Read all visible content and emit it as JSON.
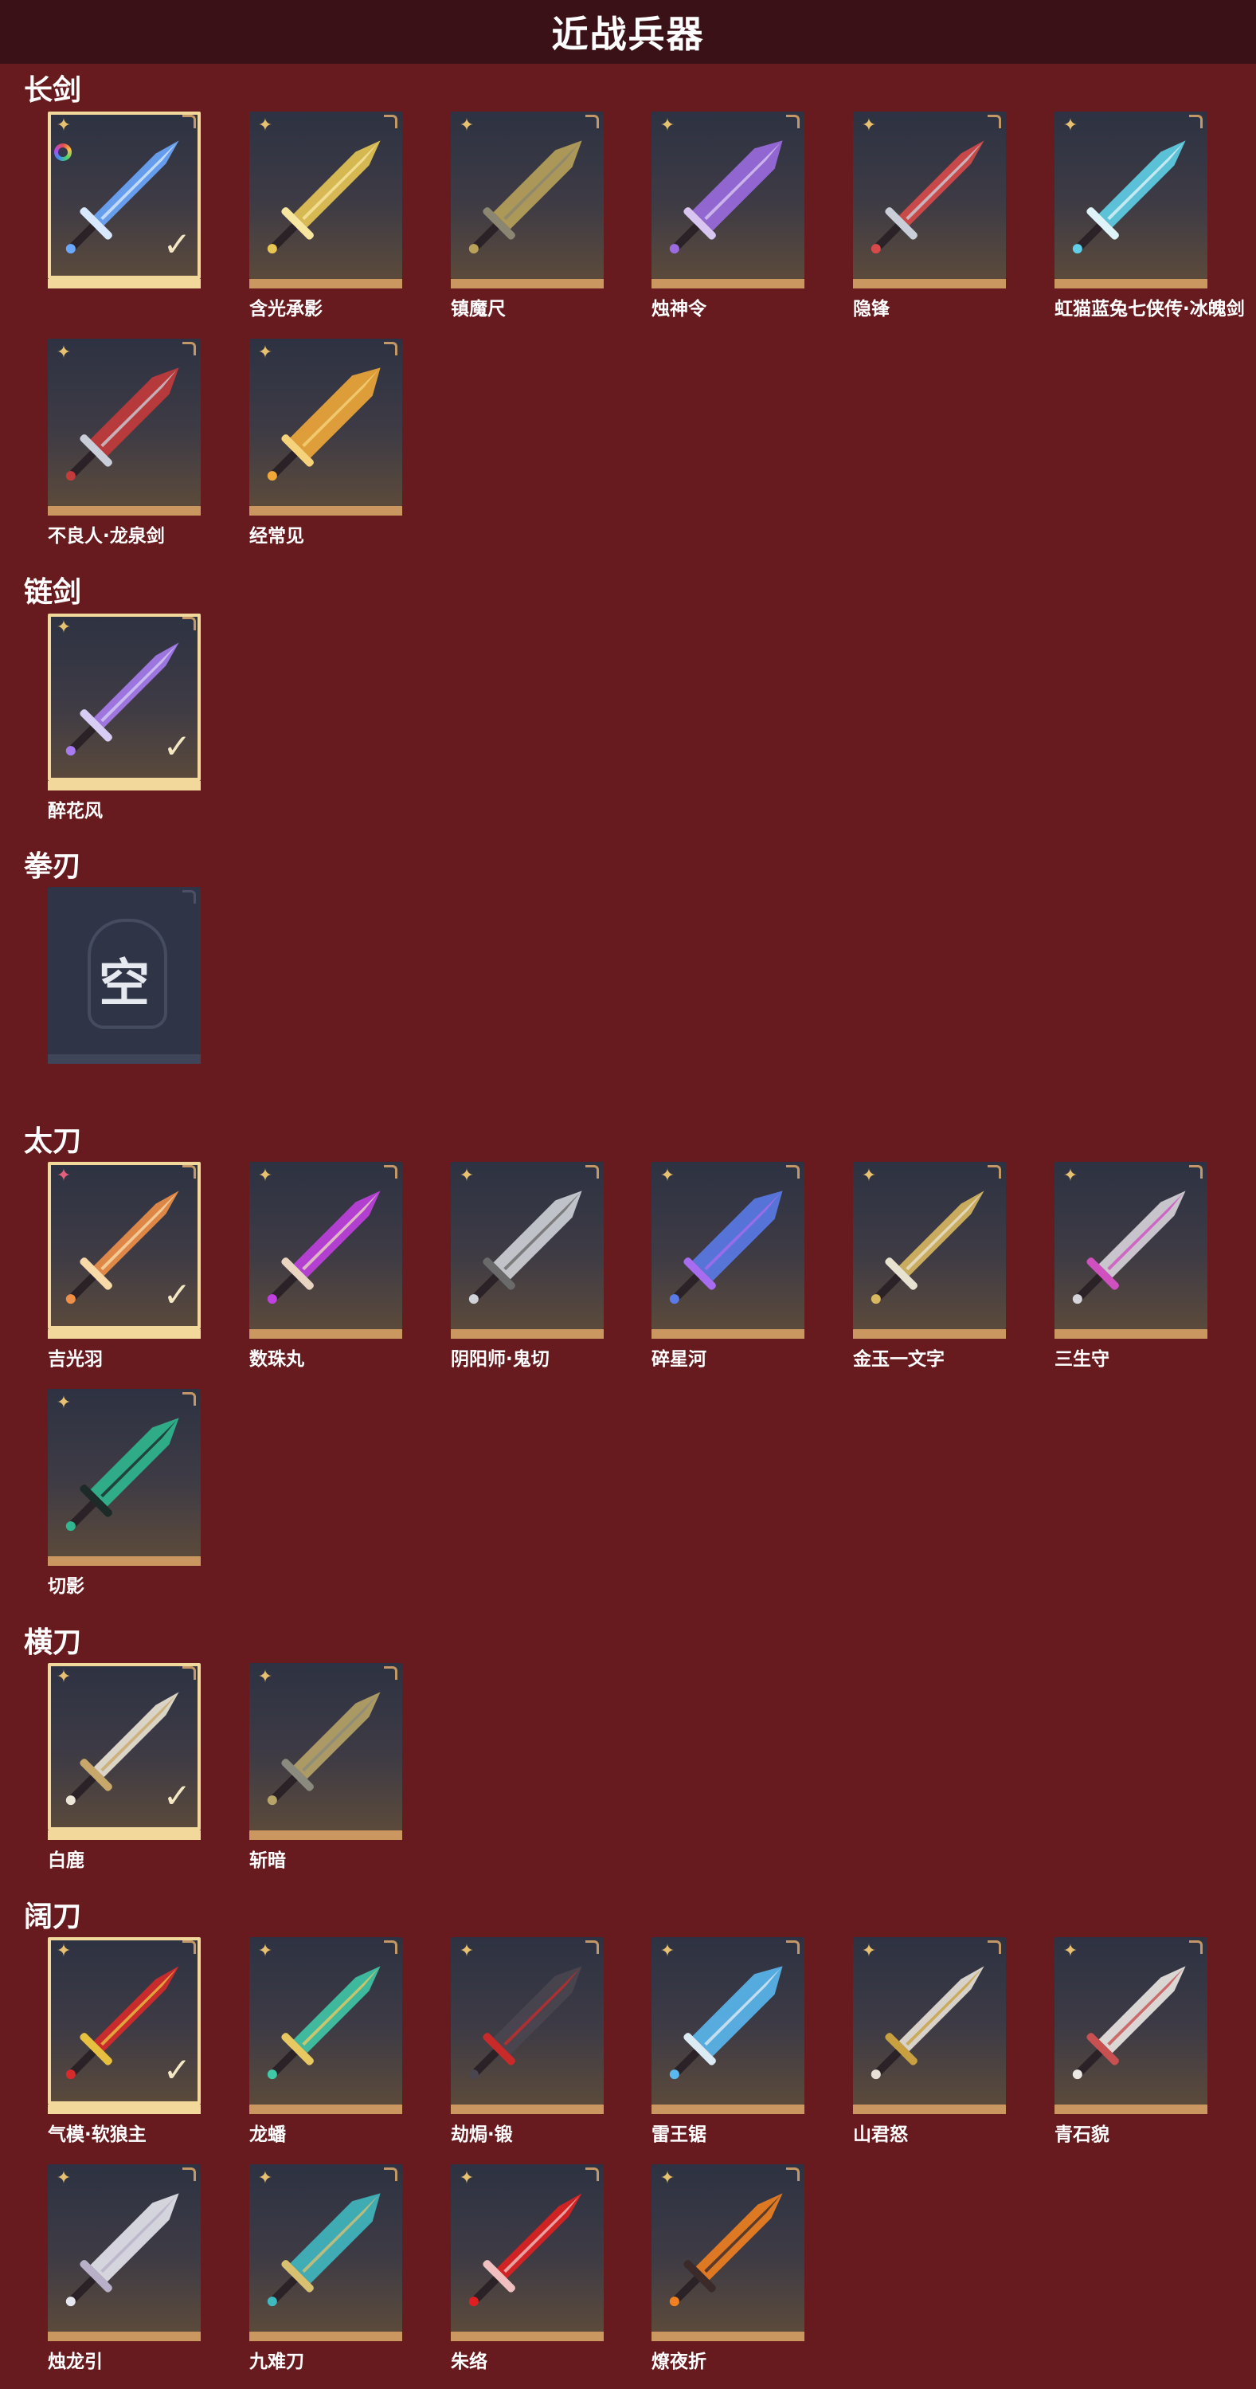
{
  "page": {
    "title": "近战兵器"
  },
  "sections": {
    "longsword": {
      "title": "长剑",
      "items": [
        {
          "label": "",
          "selected": true,
          "colors": [
            "#6aa8ff",
            "#d8e8ff"
          ]
        },
        {
          "label": "含光承影",
          "colors": [
            "#e8c655",
            "#f7e6a0"
          ]
        },
        {
          "label": "镇魔尺",
          "colors": [
            "#b8a25a",
            "#8a8672"
          ]
        },
        {
          "label": "烛神令",
          "colors": [
            "#9b6be0",
            "#d8c6f0"
          ]
        },
        {
          "label": "隐锋",
          "colors": [
            "#d84a4a",
            "#c9ced8"
          ]
        },
        {
          "label": "虹猫蓝兔七侠传·冰魄剑",
          "colors": [
            "#5fd0e8",
            "#dff4f8"
          ]
        },
        {
          "label": "不良人·龙泉剑",
          "colors": [
            "#c43b3b",
            "#c9ced8"
          ]
        },
        {
          "label": "经常见",
          "colors": [
            "#f0a838",
            "#f6d27a"
          ]
        }
      ]
    },
    "chainsword": {
      "title": "链剑",
      "items": [
        {
          "label": "醉花风",
          "selected": true,
          "colors": [
            "#a87cf0",
            "#d6ccf4"
          ]
        }
      ]
    },
    "fistblade": {
      "title": "拳刃",
      "empty_text": "空"
    },
    "tachi": {
      "title": "太刀",
      "items": [
        {
          "label": "吉光羽",
          "selected": true,
          "pink": true,
          "colors": [
            "#f09048",
            "#f8d9a8"
          ]
        },
        {
          "label": "数珠丸",
          "colors": [
            "#c040e0",
            "#e8d4c0"
          ]
        },
        {
          "label": "阴阳师·鬼切",
          "colors": [
            "#cfd2d8",
            "#6a6a6a"
          ]
        },
        {
          "label": "碎星河",
          "colors": [
            "#5a7ae8",
            "#a86cf0"
          ]
        },
        {
          "label": "金玉一文字",
          "colors": [
            "#d8b860",
            "#e8e2d0"
          ]
        },
        {
          "label": "三生守",
          "colors": [
            "#d8d4dc",
            "#d050c0"
          ]
        },
        {
          "label": "切影",
          "colors": [
            "#2fb890",
            "#1c2a28"
          ]
        }
      ]
    },
    "hengdao": {
      "title": "横刀",
      "items": [
        {
          "label": "白鹿",
          "selected": true,
          "colors": [
            "#ece6d6",
            "#c8a76a"
          ]
        },
        {
          "label": "斩暗",
          "colors": [
            "#b8a468",
            "#8a8a7e"
          ]
        }
      ]
    },
    "broadblade": {
      "title": "阔刀",
      "items": [
        {
          "label": "气模·软狼主",
          "selected": true,
          "colors": [
            "#d82a2a",
            "#e8c040"
          ]
        },
        {
          "label": "龙蟠",
          "colors": [
            "#40c8a8",
            "#e8c860"
          ]
        },
        {
          "label": "劫焗·锻",
          "colors": [
            "#4a4650",
            "#c82a2a"
          ]
        },
        {
          "label": "雷王锯",
          "colors": [
            "#5ab8f0",
            "#dceaf4"
          ]
        },
        {
          "label": "山君怒",
          "colors": [
            "#e8e2d8",
            "#c8a040"
          ]
        },
        {
          "label": "青石貌",
          "colors": [
            "#ece8e4",
            "#c85050"
          ]
        },
        {
          "label": "烛龙引",
          "colors": [
            "#e6e6ee",
            "#b8b0c8"
          ]
        },
        {
          "label": "九难刀",
          "colors": [
            "#40b8c0",
            "#d8c070"
          ]
        },
        {
          "label": "朱络",
          "colors": [
            "#e02020",
            "#f0c0c0"
          ]
        },
        {
          "label": "燎夜折",
          "colors": [
            "#f08020",
            "#3a2a2a"
          ]
        }
      ]
    }
  },
  "colors": {
    "background": "#671b1f",
    "titlebar": "#3a1116",
    "rarity_bar": "#c9975f",
    "selected_frame": "#f2d89a"
  },
  "icons": {
    "rarity": "four-point-star-icon",
    "selected": "checkmark-icon",
    "frame_corner": "corner-bracket-icon"
  }
}
